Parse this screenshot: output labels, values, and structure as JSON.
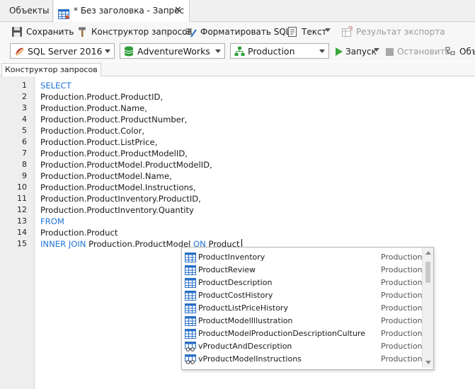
{
  "tabs": {
    "objects_label": "Объекты",
    "document_label": "* Без заголовка - Запрос",
    "close_glyph": "✕"
  },
  "toolbar": {
    "save_label": "Сохранить",
    "query_builder_label": "Конструктор запросов",
    "format_sql_label": "Форматировать SQL",
    "text_label": "Текст",
    "export_result_label": "Результат экспорта"
  },
  "connection_bar": {
    "server": "SQL Server 2016",
    "database": "AdventureWorks",
    "schema": "Production",
    "run_label": "Запуск",
    "stop_label": "Остановить",
    "explain_label": "Объ"
  },
  "subtabs": {
    "query_builder_tab": "Конструктор запросов"
  },
  "editor": {
    "lines": [
      {
        "num": "1",
        "segments": [
          {
            "text": "SELECT",
            "kw": true
          }
        ]
      },
      {
        "num": "2",
        "segments": [
          {
            "text": "Production.Product.ProductID,",
            "kw": false
          }
        ]
      },
      {
        "num": "3",
        "segments": [
          {
            "text": "Production.Product.Name,",
            "kw": false
          }
        ]
      },
      {
        "num": "4",
        "segments": [
          {
            "text": "Production.Product.ProductNumber,",
            "kw": false
          }
        ]
      },
      {
        "num": "5",
        "segments": [
          {
            "text": "Production.Product.Color,",
            "kw": false
          }
        ]
      },
      {
        "num": "6",
        "segments": [
          {
            "text": "Production.Product.ListPrice,",
            "kw": false
          }
        ]
      },
      {
        "num": "7",
        "segments": [
          {
            "text": "Production.Product.ProductModelID,",
            "kw": false
          }
        ]
      },
      {
        "num": "8",
        "segments": [
          {
            "text": "Production.ProductModel.ProductModelID,",
            "kw": false
          }
        ]
      },
      {
        "num": "9",
        "segments": [
          {
            "text": "Production.ProductModel.Name,",
            "kw": false
          }
        ]
      },
      {
        "num": "10",
        "segments": [
          {
            "text": "Production.ProductModel.Instructions,",
            "kw": false
          }
        ]
      },
      {
        "num": "11",
        "segments": [
          {
            "text": "Production.ProductInventory.ProductID,",
            "kw": false
          }
        ]
      },
      {
        "num": "12",
        "segments": [
          {
            "text": "Production.ProductInventory.Quantity",
            "kw": false
          }
        ]
      },
      {
        "num": "13",
        "segments": [
          {
            "text": "FROM",
            "kw": true
          }
        ]
      },
      {
        "num": "14",
        "segments": [
          {
            "text": "Production.Product",
            "kw": false
          }
        ]
      },
      {
        "num": "15",
        "segments": [
          {
            "text": "INNER JOIN",
            "kw": true
          },
          {
            "text": " Production.ProductModel ",
            "kw": false
          },
          {
            "text": "ON",
            "kw": true
          },
          {
            "text": " Product",
            "kw": false
          }
        ],
        "caret": true
      }
    ]
  },
  "autocomplete": {
    "items": [
      {
        "name": "ProductInventory",
        "schema": "Production",
        "icon": "table-icon"
      },
      {
        "name": "ProductReview",
        "schema": "Production",
        "icon": "table-icon"
      },
      {
        "name": "ProductDescription",
        "schema": "Production",
        "icon": "table-icon"
      },
      {
        "name": "ProductCostHistory",
        "schema": "Production",
        "icon": "table-icon"
      },
      {
        "name": "ProductListPriceHistory",
        "schema": "Production",
        "icon": "table-icon"
      },
      {
        "name": "ProductModelIllustration",
        "schema": "Production",
        "icon": "table-icon"
      },
      {
        "name": "ProductModelProductionDescriptionCulture",
        "schema": "Production",
        "icon": "table-icon"
      },
      {
        "name": "vProductAndDescription",
        "schema": "Production",
        "icon": "view-icon"
      },
      {
        "name": "vProductModelInstructions",
        "schema": "Production",
        "icon": "view-icon"
      }
    ]
  },
  "colors": {
    "keyword": "#1f74d8",
    "run_green": "#3aa63a",
    "table_icon_blue": "#2a6fc9"
  }
}
